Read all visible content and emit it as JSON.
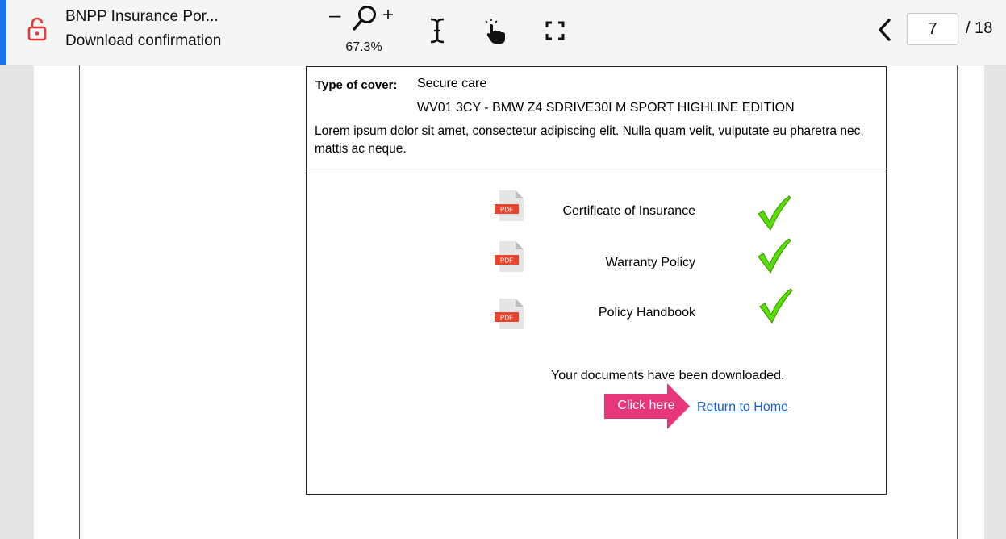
{
  "toolbar": {
    "title": "BNPP Insurance Por...",
    "subtitle": "Download confirmation",
    "zoom_minus": "–",
    "zoom_plus": "+",
    "zoom_level": "67.3%",
    "page_current": "7",
    "page_total": "/ 18",
    "accent_color": "#1a73e8",
    "lock_color": "#e53935",
    "icons": [
      "lock-open-icon",
      "zoom-magnifier-icon",
      "text-select-icon",
      "hand-pointer-icon",
      "fullscreen-icon",
      "chevron-left-icon"
    ]
  },
  "document": {
    "cover_label": "Type of cover:",
    "cover_value": "Secure care",
    "vehicle": "WV01 3CY - BMW Z4 SDRIVE30I M SPORT HIGHLINE EDITION",
    "description": "Lorem ipsum dolor sit amet, consectetur adipiscing elit. Nulla quam velit, vulputate eu pharetra nec, mattis ac neque.",
    "files": [
      {
        "icon_label": "PDF",
        "name": "Certificate of Insurance",
        "status_icon": "checkmark-icon"
      },
      {
        "icon_label": "PDF",
        "name": "Warranty Policy",
        "status_icon": "checkmark-icon"
      },
      {
        "icon_label": "PDF",
        "name": "Policy Handbook",
        "status_icon": "checkmark-icon"
      }
    ],
    "downloaded_message": "Your documents have been downloaded.",
    "click_here_label": "Click here",
    "return_link": "Return to Home",
    "pdf_color": "#e8452c",
    "check_color": "#55e000",
    "arrow_color": "#e8367a",
    "link_color": "#1a5fd0"
  }
}
